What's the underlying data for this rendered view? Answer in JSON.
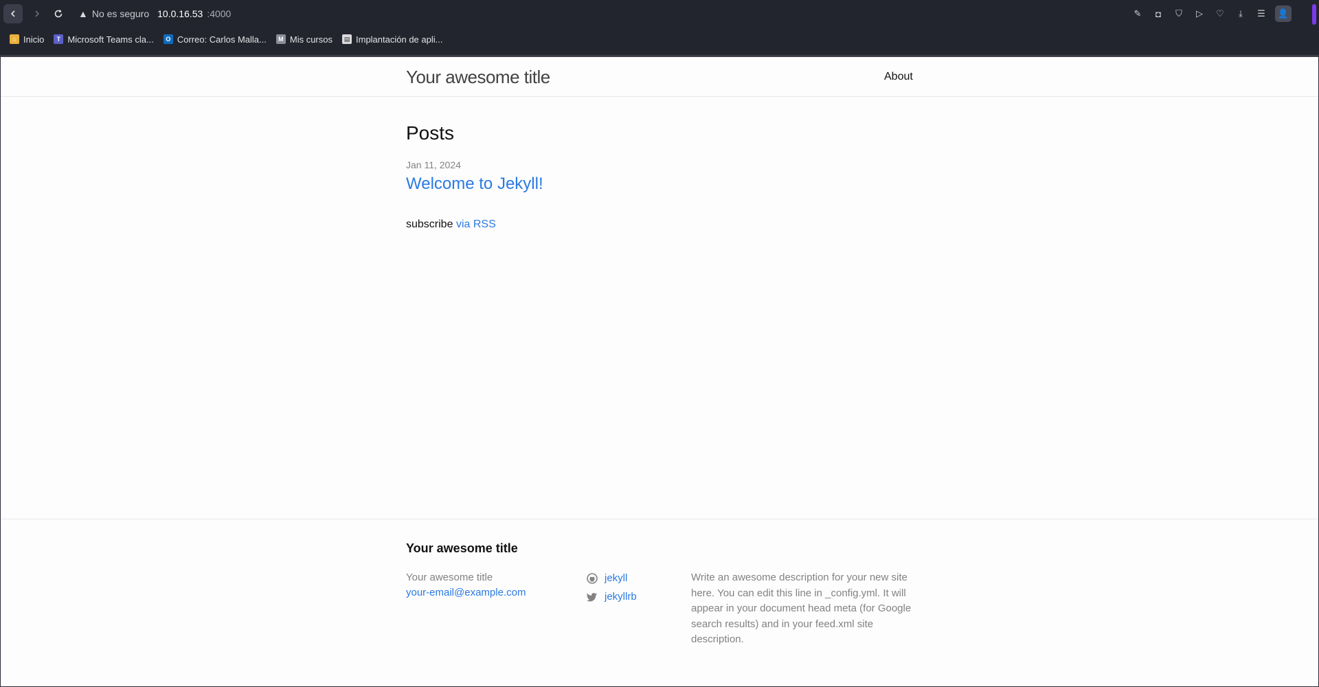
{
  "browser": {
    "security_text": "No es seguro",
    "url_host": "10.0.16.53",
    "url_port": ":4000",
    "bookmarks": [
      {
        "label": "Inicio",
        "icon": "home-icon",
        "color": "#e8b23c"
      },
      {
        "label": "Microsoft Teams cla...",
        "icon": "teams-icon",
        "color": "#5b5fc7"
      },
      {
        "label": "Correo: Carlos Malla...",
        "icon": "outlook-icon",
        "color": "#0f6cbd"
      },
      {
        "label": "Mis cursos",
        "icon": "moodle-icon",
        "color": "#8a8d98"
      },
      {
        "label": "Implantación de apli...",
        "icon": "document-icon",
        "color": "#d9d9de"
      }
    ]
  },
  "site": {
    "title": "Your awesome title",
    "nav": {
      "about": "About"
    }
  },
  "main": {
    "heading": "Posts",
    "posts": [
      {
        "date": "Jan 11, 2024",
        "title": "Welcome to Jekyll!"
      }
    ],
    "rss_prefix": "subscribe",
    "rss_link": "via RSS"
  },
  "footer": {
    "heading": "Your awesome title",
    "name": "Your awesome title",
    "email": "your-email@example.com",
    "github": "jekyll",
    "twitter": "jekyllrb",
    "description": "Write an awesome description for your new site here. You can edit this line in _config.yml. It will appear in your document head meta (for Google search results) and in your feed.xml site description."
  }
}
